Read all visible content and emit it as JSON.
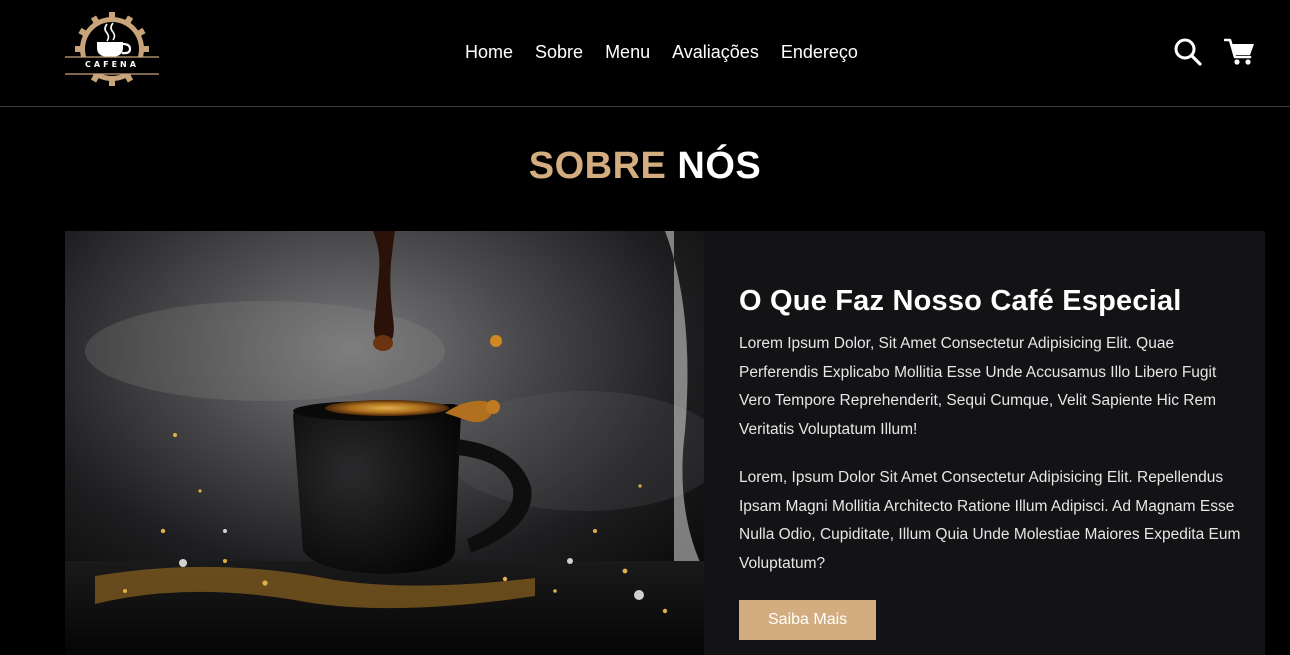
{
  "header": {
    "logo_text": "CAFENA",
    "nav": [
      {
        "label": "Home"
      },
      {
        "label": "Sobre"
      },
      {
        "label": "Menu"
      },
      {
        "label": "Avaliações"
      },
      {
        "label": "Endereço"
      }
    ],
    "icons": {
      "search": "search-icon",
      "cart": "cart-icon"
    }
  },
  "about": {
    "title_accent": "SOBRE",
    "title_main": "NÓS",
    "heading": "O Que Faz Nosso Café Especial",
    "paragraphs": [
      "Lorem Ipsum Dolor, Sit Amet Consectetur Adipisicing Elit. Quae Perferendis Explicabo Mollitia Esse Unde Accusamus Illo Libero Fugit Vero Tempore Reprehenderit, Sequi Cumque, Velit Sapiente Hic Rem Veritatis Voluptatum Illum!",
      "Lorem, Ipsum Dolor Sit Amet Consectetur Adipisicing Elit. Repellendus Ipsam Magni Mollitia Architecto Ratione Illum Adipisci. Ad Magnam Esse Nulla Odio, Cupiditate, Illum Quia Unde Molestiae Maiores Expedita Eum Voluptatum?"
    ],
    "button_label": "Saiba Mais"
  },
  "colors": {
    "accent": "#d3ad7f",
    "background": "#000000",
    "card": "#131316",
    "text": "#ffffff"
  }
}
